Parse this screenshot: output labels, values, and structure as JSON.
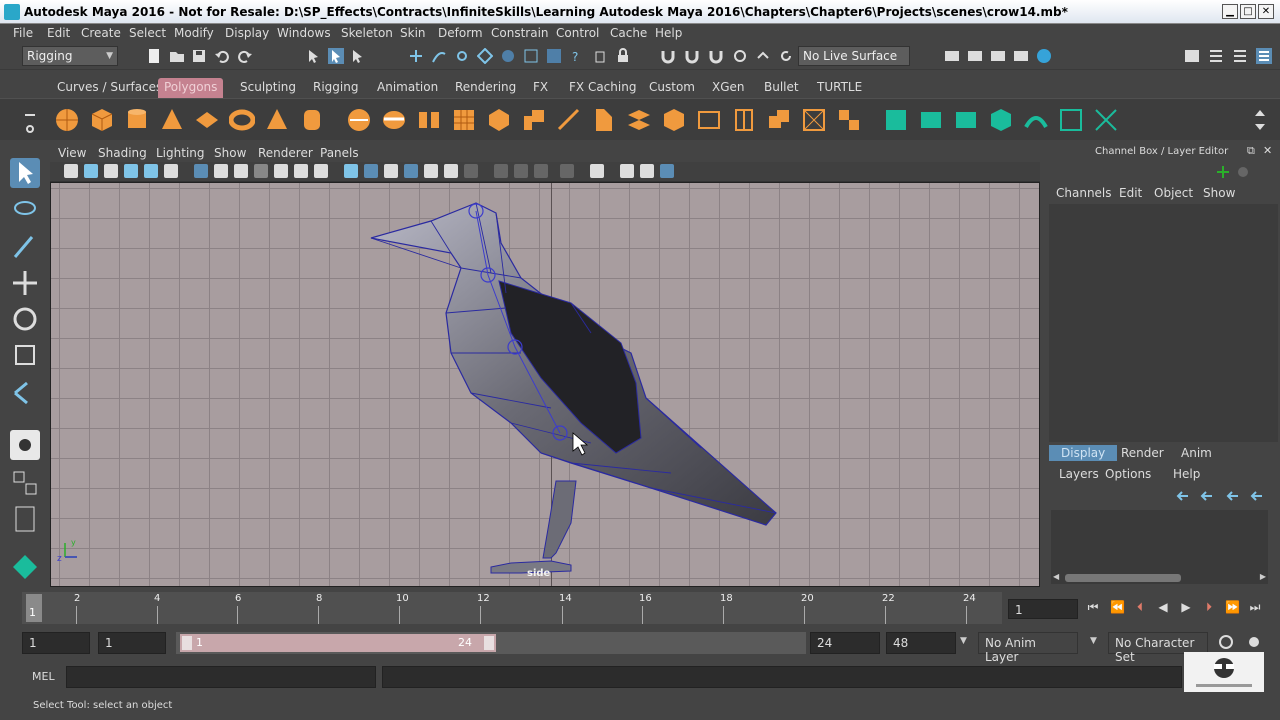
{
  "window": {
    "title": "Autodesk Maya 2016 - Not for Resale: D:\\SP_Effects\\Contracts\\InfiniteSkills\\Learning Autodesk Maya 2016\\Chapters\\Chapter6\\Projects\\scenes\\crow14.mb*"
  },
  "menu": [
    "File",
    "Edit",
    "Create",
    "Select",
    "Modify",
    "Display",
    "Windows",
    "Skeleton",
    "Skin",
    "Deform",
    "Constrain",
    "Control",
    "Cache",
    "Help"
  ],
  "status": {
    "menu_set": "Rigging",
    "live_surface": "No Live Surface"
  },
  "shelf": {
    "tabs": [
      "Curves / Surfaces",
      "Polygons",
      "Sculpting",
      "Rigging",
      "Animation",
      "Rendering",
      "FX",
      "FX Caching",
      "Custom",
      "XGen",
      "Bullet",
      "TURTLE"
    ],
    "active": "Polygons"
  },
  "viewport": {
    "menu": [
      "View",
      "Shading",
      "Lighting",
      "Show",
      "Renderer",
      "Panels"
    ],
    "camera_label": "side"
  },
  "channel_box": {
    "title": "Channel Box / Layer Editor",
    "menu": [
      "Channels",
      "Edit",
      "Object",
      "Show"
    ],
    "layer_tabs": [
      "Display",
      "Render",
      "Anim"
    ],
    "layer_menu": [
      "Layers",
      "Options",
      "Help"
    ]
  },
  "timeline": {
    "tick_labels": [
      "2",
      "4",
      "6",
      "8",
      "10",
      "12",
      "14",
      "16",
      "18",
      "20",
      "22",
      "24"
    ],
    "current_frame": "1",
    "current_field": "1"
  },
  "range": {
    "start": "1",
    "playback_start": "1",
    "slider_start": "1",
    "slider_end": "24",
    "playback_end": "24",
    "end": "48",
    "anim_layer": "No Anim Layer",
    "character_set": "No Character Set"
  },
  "command": {
    "label": "MEL",
    "help": "Select Tool: select an object"
  },
  "colors": {
    "active_shelf_tab": "#c58290",
    "active_layer_tab": "#5b8db5",
    "viewport_bg": "#a89d9f",
    "wire": "#2a2aa0"
  }
}
